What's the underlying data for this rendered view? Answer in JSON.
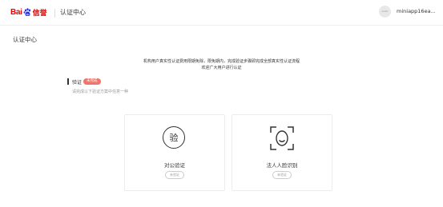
{
  "header": {
    "logo_bai": "Bai",
    "logo_suffix": "信誉",
    "page_name": "认证中心",
    "avatar_text": "avatar",
    "username": "miniapp16ea..."
  },
  "main": {
    "title": "认证中心",
    "notice_line1": "机构用户真实性认证费用限期免除，限免期内，完成验证步骤即完成全部真实性认证流程",
    "notice_line2": "欢迎广大用户进行认证",
    "section_label": "验证",
    "section_badge": "未完成",
    "section_hint": "请完成以下验证方案中任意一种"
  },
  "cards": [
    {
      "icon_char": "验",
      "title": "对公验证",
      "tag": "未验证"
    },
    {
      "title": "法人人脸识别",
      "tag": "未验证"
    }
  ],
  "colors": {
    "brand_red": "#e10601",
    "badge_bg": "#f0766b",
    "paw_blue": "#2932e1"
  },
  "icons": [
    "baidu-paw-icon",
    "verify-char-icon",
    "face-scan-icon"
  ]
}
